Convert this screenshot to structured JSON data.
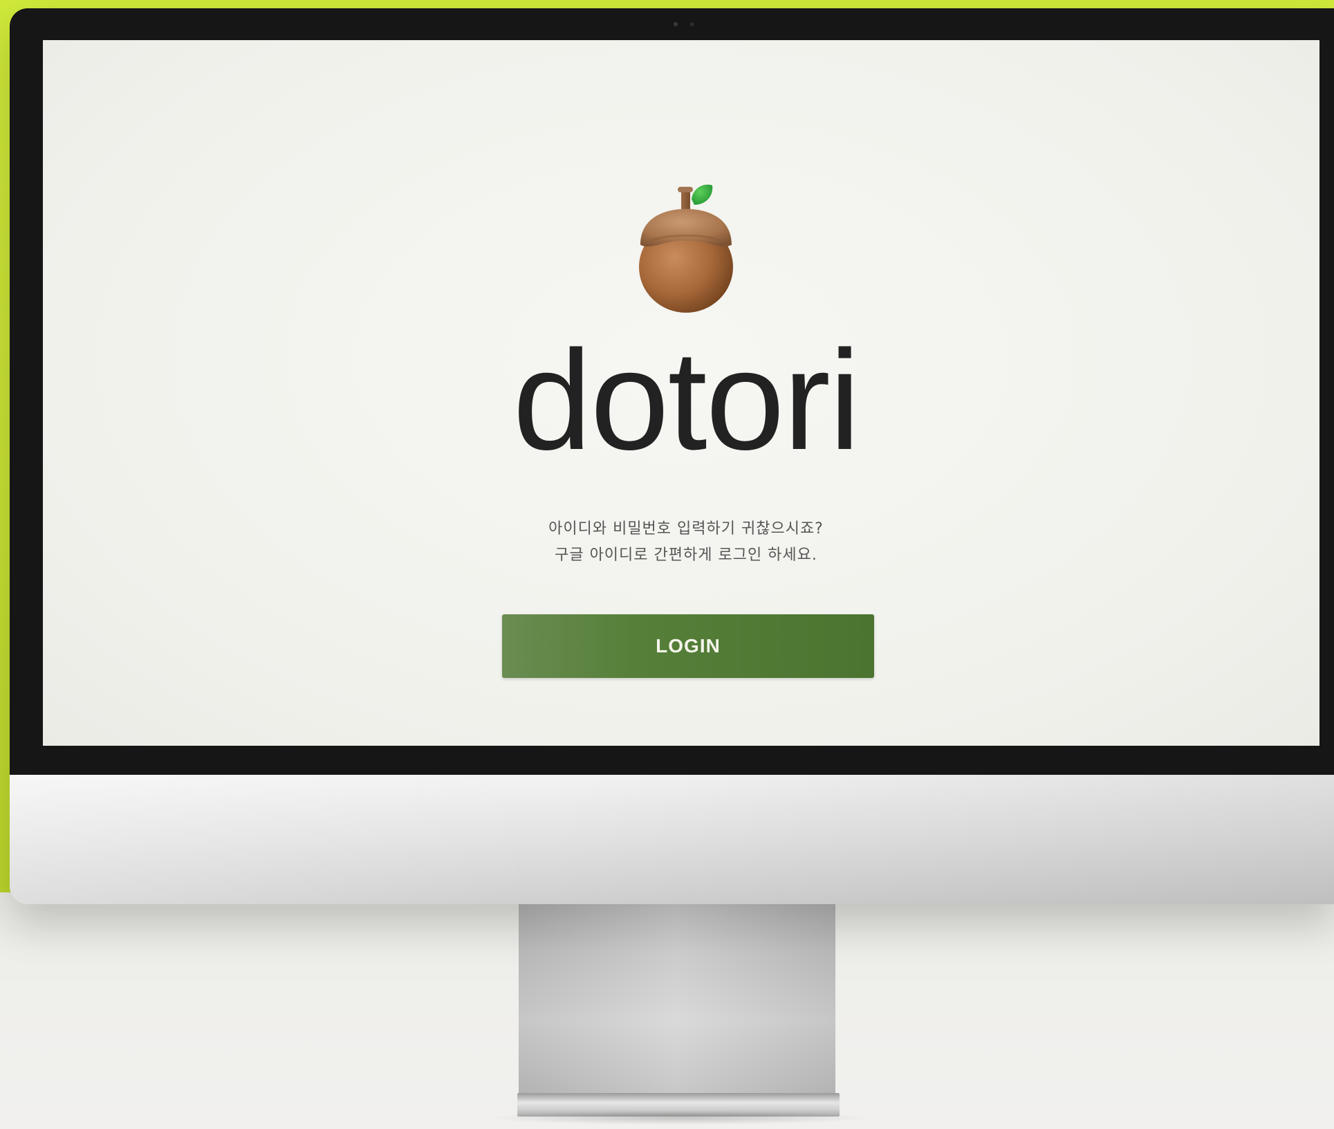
{
  "app": {
    "brand_name": "dotori",
    "logo_icon": "acorn-icon"
  },
  "login": {
    "tagline_line1": "아이디와 비밀번호 입력하기 귀찮으시죠?",
    "tagline_line2": "구글 아이디로 간편하게 로그인 하세요.",
    "button_label": "LOGIN"
  },
  "colors": {
    "backdrop": "#c7e033",
    "button": "#56803a",
    "button_text": "#f4f4ea",
    "brand_text": "#222222",
    "screen_bg": "#f3f3ef",
    "bezel": "#161616"
  }
}
